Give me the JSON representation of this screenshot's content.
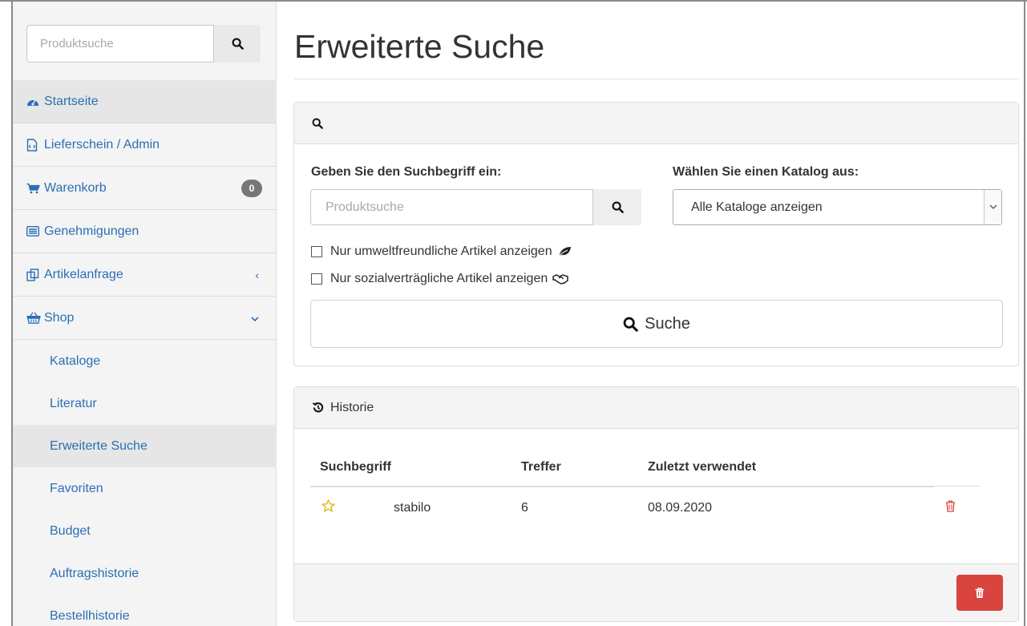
{
  "sidebar": {
    "search_placeholder": "Produktsuche",
    "items": [
      {
        "label": "Startseite",
        "icon": "dashboard-icon"
      },
      {
        "label": "Lieferschein / Admin",
        "icon": "file-code-icon"
      },
      {
        "label": "Warenkorb",
        "icon": "cart-icon",
        "badge": "0"
      },
      {
        "label": "Genehmigungen",
        "icon": "list-icon"
      },
      {
        "label": "Artikelanfrage",
        "icon": "copy-icon"
      },
      {
        "label": "Shop",
        "icon": "basket-icon"
      }
    ],
    "shop_sub": [
      "Kataloge",
      "Literatur",
      "Erweiterte Suche",
      "Favoriten",
      "Budget",
      "Auftragshistorie",
      "Bestellhistorie"
    ]
  },
  "page": {
    "title": "Erweiterte Suche"
  },
  "search_panel": {
    "term_label": "Geben Sie den Suchbegriff ein:",
    "term_placeholder": "Produktsuche",
    "catalog_label": "Wählen Sie einen Katalog aus:",
    "catalog_selected": "Alle Kataloge anzeigen",
    "eco_label": "Nur umweltfreundliche Artikel anzeigen",
    "social_label": "Nur sozialverträgliche Artikel anzeigen",
    "submit_label": "Suche"
  },
  "history": {
    "title": "Historie",
    "columns": [
      "Suchbegriff",
      "Treffer",
      "Zuletzt verwendet"
    ],
    "rows": [
      {
        "term": "stabilo",
        "hits": "6",
        "last_used": "08.09.2020"
      }
    ]
  },
  "colors": {
    "link": "#2a6fb5",
    "danger": "#d9443e",
    "star": "#e0b400",
    "badge": "#777777"
  }
}
